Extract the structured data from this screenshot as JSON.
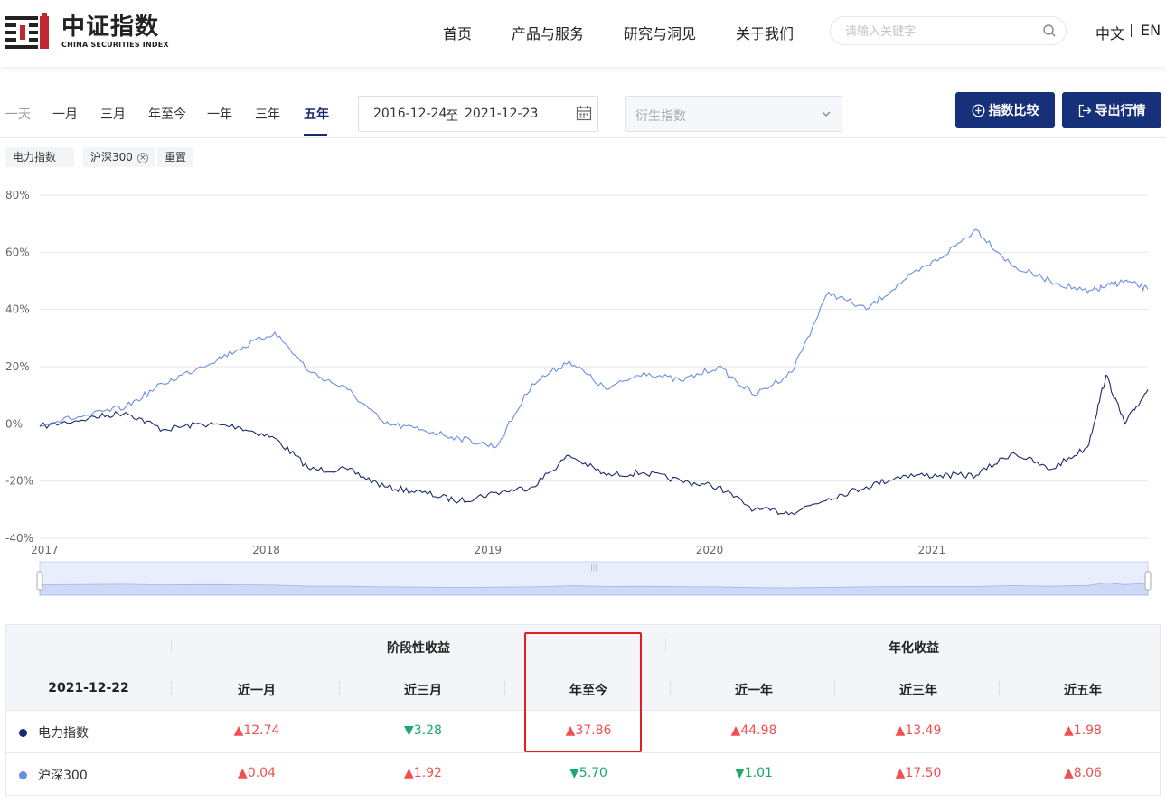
{
  "brand": {
    "name_cn": "中证指数",
    "name_en": "CHINA SECURITIES INDEX",
    "color": "#c0282d"
  },
  "nav": {
    "items": [
      "首页",
      "产品与服务",
      "研究与洞见",
      "关于我们"
    ],
    "search_placeholder": "请输入关键字",
    "lang_cn": "中文",
    "lang_sep": "|",
    "lang_en": "EN"
  },
  "toolbar": {
    "periods": [
      "一天",
      "一月",
      "三月",
      "年至今",
      "一年",
      "三年",
      "五年"
    ],
    "active_period": "五年",
    "date_start": "2016-12-24",
    "date_sep": "至",
    "date_end": "2021-12-23",
    "derivative_placeholder": "衍生指数",
    "compare_label": "指数比较",
    "export_label": "导出行情",
    "accent_color": "#17307a"
  },
  "tags": {
    "index_tag": "电力指数",
    "compare_tag": "沪深300",
    "reset_label": "重置"
  },
  "chart_data": {
    "type": "line",
    "ylim": [
      -40,
      80
    ],
    "yticks": [
      "80%",
      "60%",
      "40%",
      "20%",
      "0%",
      "-20%",
      "-40%"
    ],
    "xticks": [
      "2017",
      "2018",
      "2019",
      "2020",
      "2021"
    ],
    "grid": true,
    "series": [
      {
        "name": "电力指数",
        "color": "#1a2a6c",
        "x": [
          "2017-01",
          "2017-03",
          "2017-05",
          "2017-07",
          "2017-09",
          "2017-11",
          "2018-01",
          "2018-03",
          "2018-05",
          "2018-07",
          "2018-09",
          "2018-11",
          "2019-01",
          "2019-03",
          "2019-05",
          "2019-07",
          "2019-09",
          "2019-11",
          "2020-01",
          "2020-03",
          "2020-05",
          "2020-07",
          "2020-09",
          "2020-11",
          "2021-01",
          "2021-03",
          "2021-05",
          "2021-07",
          "2021-09",
          "2021-10",
          "2021-11",
          "2021-12"
        ],
        "values": [
          -1,
          2,
          4,
          -2,
          0,
          -1,
          -5,
          -16,
          -16,
          -22,
          -24,
          -27,
          -24,
          -22,
          -11,
          -18,
          -17,
          -20,
          -22,
          -30,
          -31,
          -26,
          -22,
          -18,
          -18,
          -18,
          -10,
          -16,
          -8,
          17,
          0,
          12
        ]
      },
      {
        "name": "沪深300",
        "color": "#6a8ee6",
        "x": [
          "2017-01",
          "2017-03",
          "2017-05",
          "2017-07",
          "2017-09",
          "2017-11",
          "2018-01",
          "2018-03",
          "2018-05",
          "2018-07",
          "2018-09",
          "2018-11",
          "2019-01",
          "2019-03",
          "2019-05",
          "2019-07",
          "2019-09",
          "2019-11",
          "2020-01",
          "2020-03",
          "2020-05",
          "2020-07",
          "2020-09",
          "2020-11",
          "2021-01",
          "2021-03",
          "2021-05",
          "2021-07",
          "2021-09",
          "2021-10",
          "2021-11",
          "2021-12"
        ],
        "values": [
          0,
          3,
          6,
          14,
          20,
          26,
          32,
          18,
          12,
          0,
          -2,
          -5,
          -8,
          14,
          22,
          12,
          18,
          15,
          20,
          10,
          18,
          46,
          40,
          50,
          58,
          68,
          55,
          50,
          46,
          48,
          50,
          47
        ]
      }
    ]
  },
  "returns_table": {
    "date": "2021-12-22",
    "group_periodic": "阶段性收益",
    "group_annual": "年化收益",
    "columns": [
      "近一月",
      "近三月",
      "年至今",
      "近一年",
      "近三年",
      "近五年"
    ],
    "rows": [
      {
        "name": "电力指数",
        "color": "#1a2a6c",
        "values": [
          "12.74",
          "3.28",
          "37.86",
          "44.98",
          "13.49",
          "1.98"
        ],
        "directions": [
          "up",
          "down",
          "up",
          "up",
          "up",
          "up"
        ]
      },
      {
        "name": "沪深300",
        "color": "#6a8ee6",
        "values": [
          "0.04",
          "1.92",
          "5.70",
          "1.01",
          "17.50",
          "8.06"
        ],
        "directions": [
          "up",
          "up",
          "down",
          "down",
          "up",
          "up"
        ]
      }
    ],
    "up_color": "#f05050",
    "down_color": "#1aaa6a",
    "highlight_color": "#e02020"
  }
}
